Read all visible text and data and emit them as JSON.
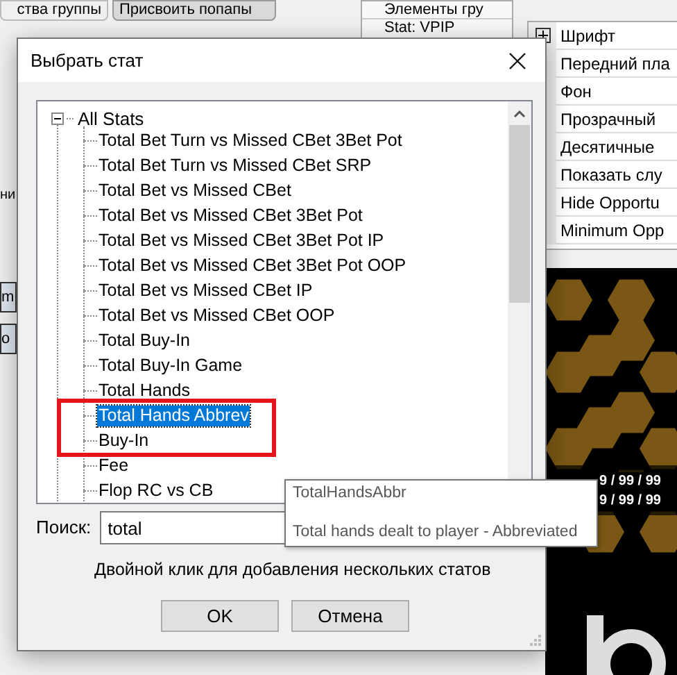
{
  "background": {
    "tabs": [
      {
        "label": "ства группы",
        "selected": false
      },
      {
        "label": "Присвоить попапы",
        "selected": true
      }
    ],
    "left_fragments": [
      "ни",
      "m",
      "o"
    ],
    "elements_panel": {
      "header": "Элементы гру",
      "items": [
        "Stat: VPIP"
      ]
    },
    "properties": [
      {
        "label": "Шрифт",
        "expandable": true
      },
      {
        "label": "Передний пла",
        "expandable": false
      },
      {
        "label": "Фон",
        "expandable": false
      },
      {
        "label": "Прозрачный",
        "expandable": false
      },
      {
        "label": "Десятичные",
        "expandable": false
      },
      {
        "label": "Показать слу",
        "expandable": false
      },
      {
        "label": "Hide Opportu",
        "expandable": false
      },
      {
        "label": "Minimum Opp",
        "expandable": false
      }
    ],
    "preview": {
      "lines": [
        "9 / 99 / 99",
        "9 / 99 / 99"
      ]
    }
  },
  "dialog": {
    "title": "Выбрать стат",
    "tree": {
      "label": "All Stats",
      "expanded": true,
      "children": [
        {
          "label": "Total Bet Turn vs Missed CBet 3Bet Pot",
          "selected": false
        },
        {
          "label": "Total Bet Turn vs Missed CBet SRP",
          "selected": false
        },
        {
          "label": "Total Bet vs Missed CBet",
          "selected": false
        },
        {
          "label": "Total Bet vs Missed CBet 3Bet Pot",
          "selected": false
        },
        {
          "label": "Total Bet vs Missed CBet 3Bet Pot IP",
          "selected": false
        },
        {
          "label": "Total Bet vs Missed CBet 3Bet Pot OOP",
          "selected": false
        },
        {
          "label": "Total Bet vs Missed CBet IP",
          "selected": false
        },
        {
          "label": "Total Bet vs Missed CBet OOP",
          "selected": false
        },
        {
          "label": "Total Buy-In",
          "selected": false
        },
        {
          "label": "Total Buy-In Game",
          "selected": false
        },
        {
          "label": "Total Hands",
          "selected": false
        },
        {
          "label": "Total Hands Abbrev",
          "selected": true
        },
        {
          "label": "Buy-In",
          "selected": false
        },
        {
          "label": "Fee",
          "selected": false
        },
        {
          "label": "Flop RC vs CB",
          "selected": false
        }
      ]
    },
    "annotation": {
      "kind": "rectangle"
    },
    "search": {
      "label": "Поиск:",
      "value": "total"
    },
    "hint": "Двойной клик для добавления нескольких статов",
    "buttons": [
      "OK",
      "Отмена"
    ],
    "tooltip": {
      "name": "TotalHandsAbbr",
      "description": "Total hands dealt to player - Abbreviated"
    }
  }
}
